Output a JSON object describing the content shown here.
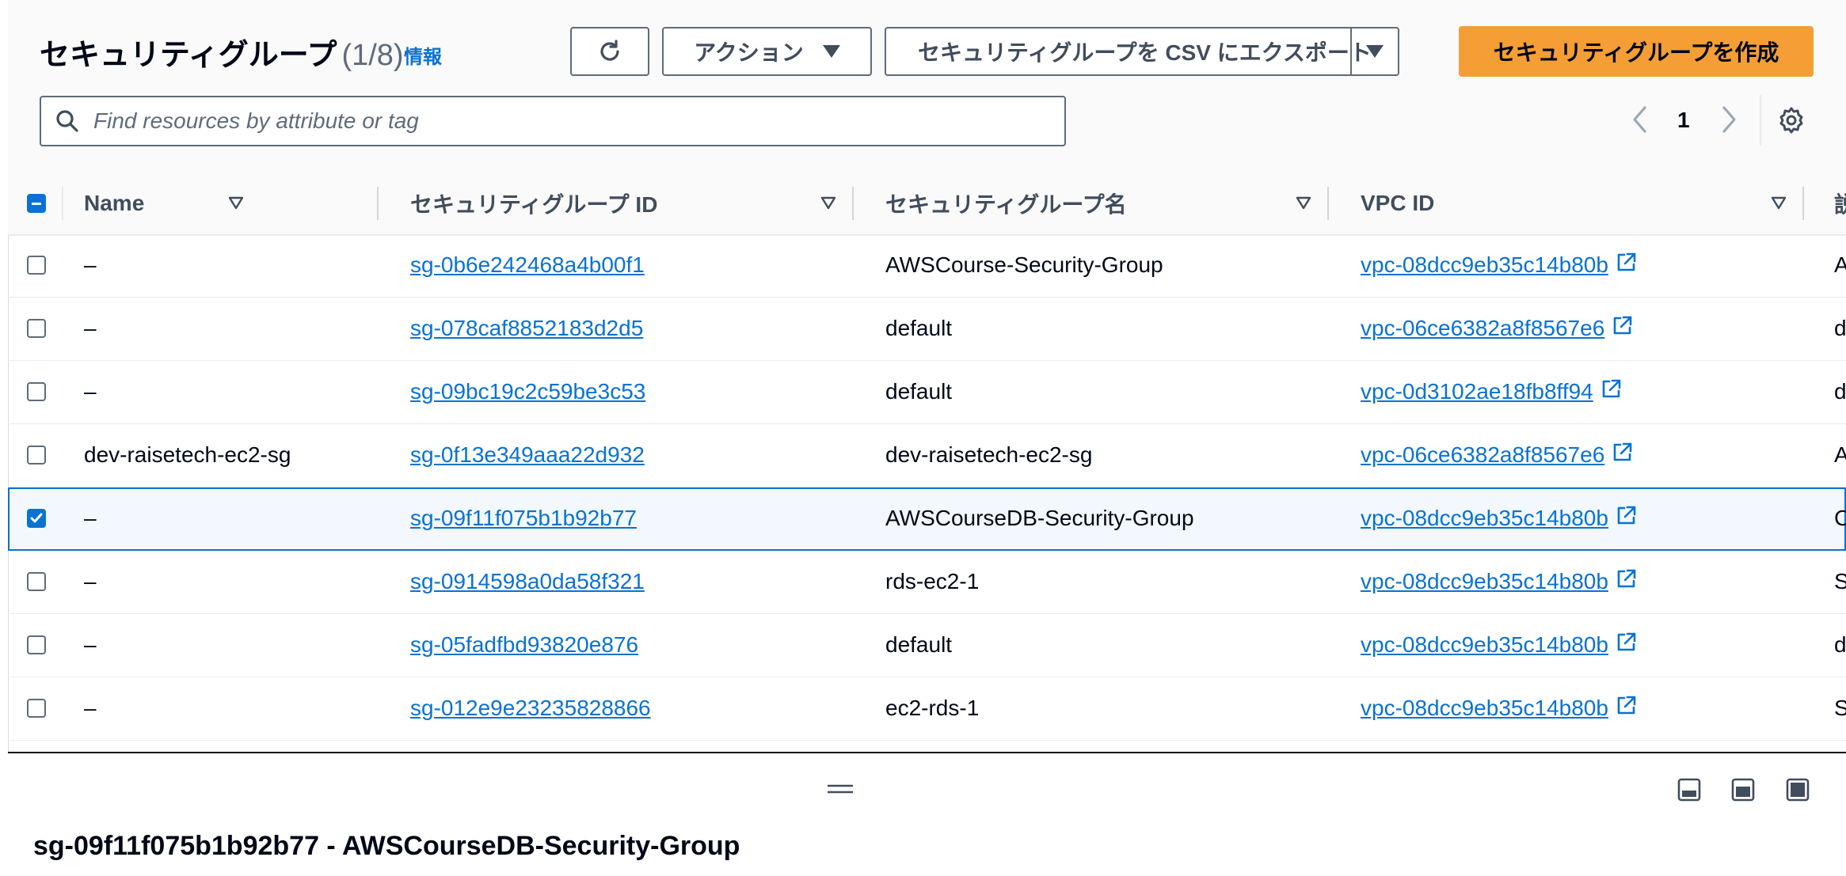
{
  "header": {
    "title": "セキュリティグループ",
    "count": "(1/8)",
    "info_link": "情報"
  },
  "toolbar": {
    "refresh_icon": "refresh-icon",
    "actions_label": "アクション",
    "export_label": "セキュリティグループを CSV にエクスポート",
    "create_label": "セキュリティグループを作成",
    "create_color": "#f59e35"
  },
  "search": {
    "placeholder": "Find resources by attribute or tag"
  },
  "pagination": {
    "current_page": "1"
  },
  "table": {
    "columns": [
      "Name",
      "セキュリティグループ ID",
      "セキュリティグループ名",
      "VPC ID",
      "説"
    ],
    "rows": [
      {
        "name": "–",
        "sg_id": "sg-0b6e242468a4b00f1",
        "sg_name": "AWSCourse-Security-Group",
        "vpc_id": "vpc-08dcc9eb35c14b80b",
        "desc": "A",
        "checked": false
      },
      {
        "name": "–",
        "sg_id": "sg-078caf8852183d2d5",
        "sg_name": "default",
        "vpc_id": "vpc-06ce6382a8f8567e6",
        "desc": "d",
        "checked": false
      },
      {
        "name": "–",
        "sg_id": "sg-09bc19c2c59be3c53",
        "sg_name": "default",
        "vpc_id": "vpc-0d3102ae18fb8ff94",
        "desc": "d",
        "checked": false
      },
      {
        "name": "dev-raisetech-ec2-sg",
        "sg_id": "sg-0f13e349aaa22d932",
        "sg_name": "dev-raisetech-ec2-sg",
        "vpc_id": "vpc-06ce6382a8f8567e6",
        "desc": "A",
        "checked": false
      },
      {
        "name": "–",
        "sg_id": "sg-09f11f075b1b92b77",
        "sg_name": "AWSCourseDB-Security-Group",
        "vpc_id": "vpc-08dcc9eb35c14b80b",
        "desc": "C",
        "checked": true
      },
      {
        "name": "–",
        "sg_id": "sg-0914598a0da58f321",
        "sg_name": "rds-ec2-1",
        "vpc_id": "vpc-08dcc9eb35c14b80b",
        "desc": "S",
        "checked": false
      },
      {
        "name": "–",
        "sg_id": "sg-05fadfbd93820e876",
        "sg_name": "default",
        "vpc_id": "vpc-08dcc9eb35c14b80b",
        "desc": "d",
        "checked": false
      },
      {
        "name": "–",
        "sg_id": "sg-012e9e23235828866",
        "sg_name": "ec2-rds-1",
        "vpc_id": "vpc-08dcc9eb35c14b80b",
        "desc": "S",
        "checked": false
      }
    ]
  },
  "detail": {
    "title": "sg-09f11f075b1b92b77 - AWSCourseDB-Security-Group"
  },
  "colors": {
    "link": "#0972d3",
    "selected_row_bg": "#f2f8fd",
    "primary_button": "#f59e35"
  }
}
